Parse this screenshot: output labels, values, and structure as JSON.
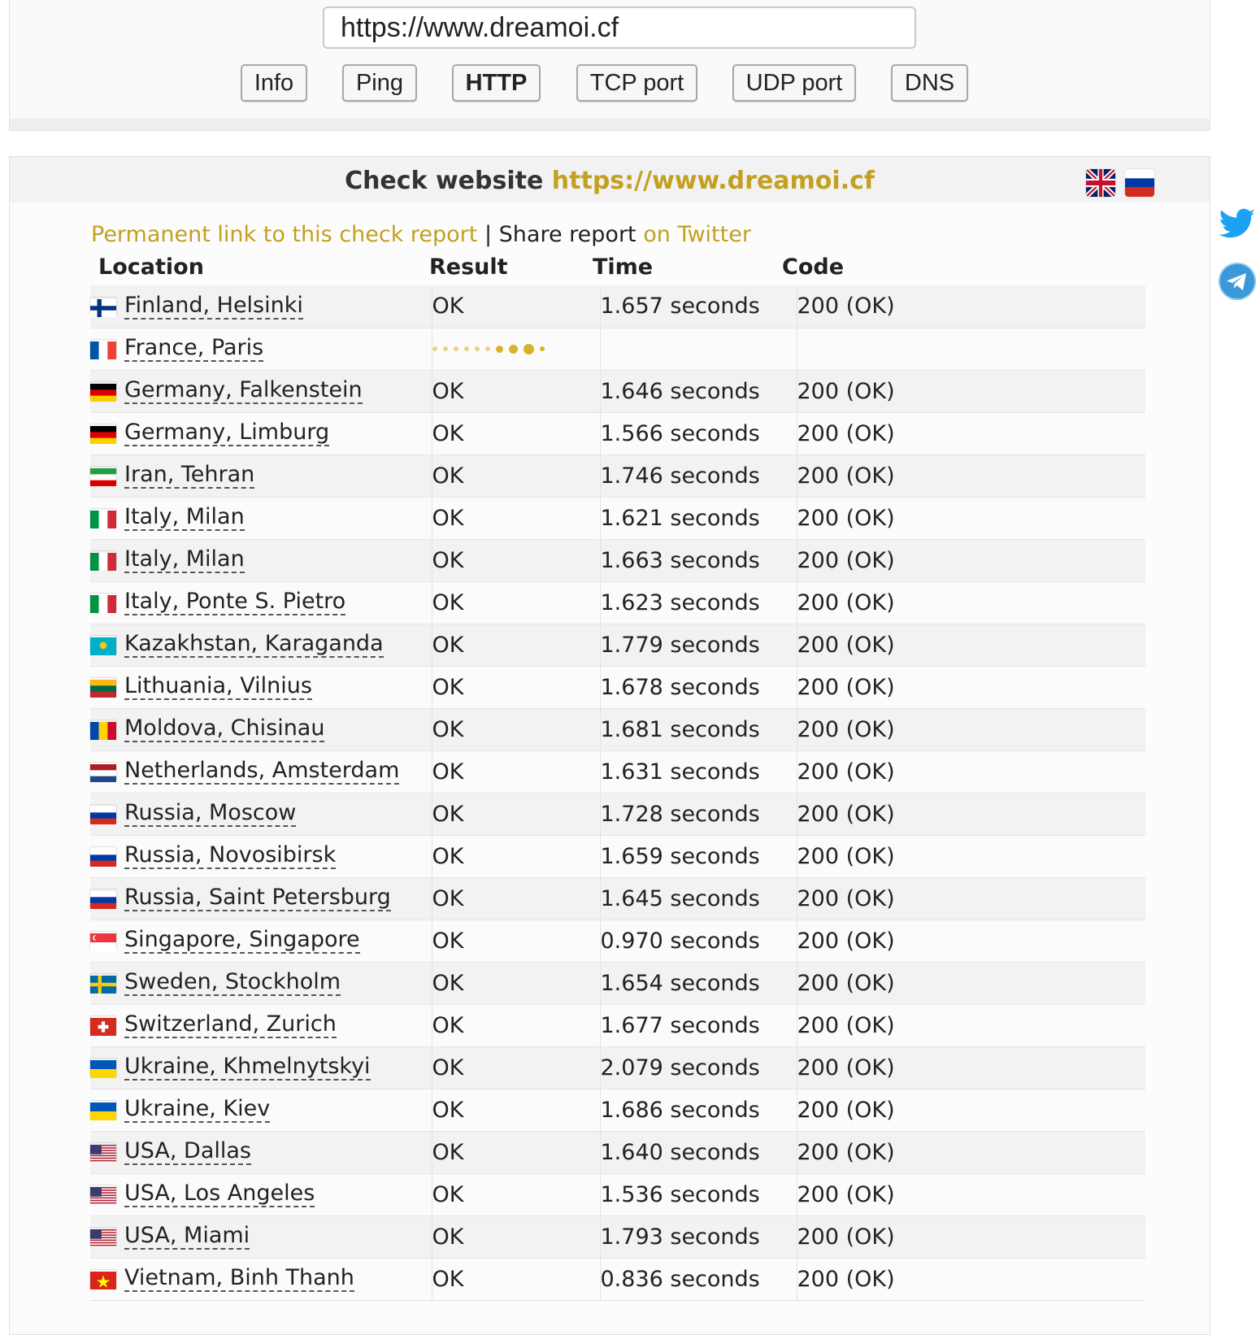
{
  "toolbar": {
    "url_value": "https://www.dreamoi.cf",
    "buttons": [
      {
        "label": "Info",
        "active": false
      },
      {
        "label": "Ping",
        "active": false
      },
      {
        "label": "HTTP",
        "active": true
      },
      {
        "label": "TCP port",
        "active": false
      },
      {
        "label": "UDP port",
        "active": false
      },
      {
        "label": "DNS",
        "active": false
      }
    ]
  },
  "report": {
    "title_prefix": "Check website",
    "title_url": "https://www.dreamoi.cf",
    "permanent_link": "Permanent link to this check report",
    "separator": "|",
    "share_text": "Share report",
    "share_link": "on Twitter",
    "columns": {
      "location": "Location",
      "result": "Result",
      "time": "Time",
      "code": "Code"
    },
    "rows": [
      {
        "flag": "fi",
        "location": "Finland, Helsinki",
        "result": "OK",
        "time": "1.657 seconds",
        "code": "200 (OK)"
      },
      {
        "flag": "fr",
        "location": "France, Paris",
        "result": "",
        "time": "",
        "code": "",
        "loading": true
      },
      {
        "flag": "de",
        "location": "Germany, Falkenstein",
        "result": "OK",
        "time": "1.646 seconds",
        "code": "200 (OK)"
      },
      {
        "flag": "de",
        "location": "Germany, Limburg",
        "result": "OK",
        "time": "1.566 seconds",
        "code": "200 (OK)"
      },
      {
        "flag": "ir",
        "location": "Iran, Tehran",
        "result": "OK",
        "time": "1.746 seconds",
        "code": "200 (OK)"
      },
      {
        "flag": "it",
        "location": "Italy, Milan",
        "result": "OK",
        "time": "1.621 seconds",
        "code": "200 (OK)"
      },
      {
        "flag": "it",
        "location": "Italy, Milan",
        "result": "OK",
        "time": "1.663 seconds",
        "code": "200 (OK)"
      },
      {
        "flag": "it",
        "location": "Italy, Ponte S. Pietro",
        "result": "OK",
        "time": "1.623 seconds",
        "code": "200 (OK)"
      },
      {
        "flag": "kz",
        "location": "Kazakhstan, Karaganda",
        "result": "OK",
        "time": "1.779 seconds",
        "code": "200 (OK)"
      },
      {
        "flag": "lt",
        "location": "Lithuania, Vilnius",
        "result": "OK",
        "time": "1.678 seconds",
        "code": "200 (OK)"
      },
      {
        "flag": "md",
        "location": "Moldova, Chisinau",
        "result": "OK",
        "time": "1.681 seconds",
        "code": "200 (OK)"
      },
      {
        "flag": "nl",
        "location": "Netherlands, Amsterdam",
        "result": "OK",
        "time": "1.631 seconds",
        "code": "200 (OK)"
      },
      {
        "flag": "ru",
        "location": "Russia, Moscow",
        "result": "OK",
        "time": "1.728 seconds",
        "code": "200 (OK)"
      },
      {
        "flag": "ru",
        "location": "Russia, Novosibirsk",
        "result": "OK",
        "time": "1.659 seconds",
        "code": "200 (OK)"
      },
      {
        "flag": "ru",
        "location": "Russia, Saint Petersburg",
        "result": "OK",
        "time": "1.645 seconds",
        "code": "200 (OK)"
      },
      {
        "flag": "sg",
        "location": "Singapore, Singapore",
        "result": "OK",
        "time": "0.970 seconds",
        "code": "200 (OK)"
      },
      {
        "flag": "se",
        "location": "Sweden, Stockholm",
        "result": "OK",
        "time": "1.654 seconds",
        "code": "200 (OK)"
      },
      {
        "flag": "ch",
        "location": "Switzerland, Zurich",
        "result": "OK",
        "time": "1.677 seconds",
        "code": "200 (OK)"
      },
      {
        "flag": "ua",
        "location": "Ukraine, Khmelnytskyi",
        "result": "OK",
        "time": "2.079 seconds",
        "code": "200 (OK)"
      },
      {
        "flag": "ua",
        "location": "Ukraine, Kiev",
        "result": "OK",
        "time": "1.686 seconds",
        "code": "200 (OK)"
      },
      {
        "flag": "us",
        "location": "USA, Dallas",
        "result": "OK",
        "time": "1.640 seconds",
        "code": "200 (OK)"
      },
      {
        "flag": "us",
        "location": "USA, Los Angeles",
        "result": "OK",
        "time": "1.536 seconds",
        "code": "200 (OK)"
      },
      {
        "flag": "us",
        "location": "USA, Miami",
        "result": "OK",
        "time": "1.793 seconds",
        "code": "200 (OK)"
      },
      {
        "flag": "vn",
        "location": "Vietnam, Binh Thanh",
        "result": "OK",
        "time": "0.836 seconds",
        "code": "200 (OK)"
      }
    ]
  },
  "language_flags": [
    "uk-flag-icon",
    "russia-flag-icon"
  ],
  "side_icons": [
    "twitter-icon",
    "telegram-icon"
  ],
  "colors": {
    "accent": "#c3a020",
    "twitter": "#1da1f2",
    "telegram": "#3a9ad9"
  }
}
